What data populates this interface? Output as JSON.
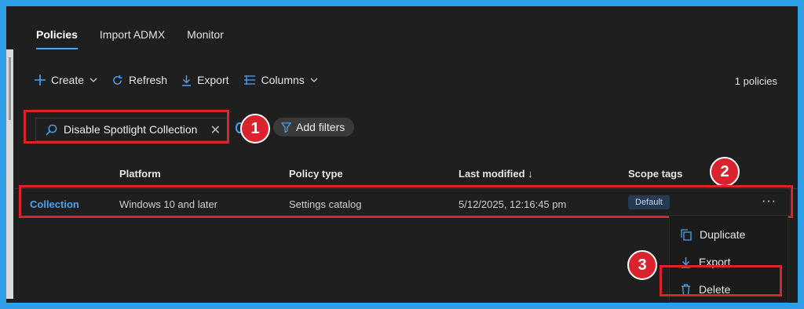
{
  "tabs": [
    {
      "label": "Policies",
      "active": true
    },
    {
      "label": "Import ADMX",
      "active": false
    },
    {
      "label": "Monitor",
      "active": false
    }
  ],
  "toolbar": {
    "create": "Create",
    "refresh": "Refresh",
    "export": "Export",
    "columns": "Columns"
  },
  "count_text": "1 policies",
  "search": {
    "value": "Disable Spotlight Collection"
  },
  "add_filters": "Add filters",
  "table": {
    "headers": {
      "platform": "Platform",
      "policy_type": "Policy type",
      "last_modified": "Last modified ↓",
      "scope_tags": "Scope tags"
    },
    "row": {
      "name": "Collection",
      "platform": "Windows 10 and later",
      "policy_type": "Settings catalog",
      "last_modified": "5/12/2025, 12:16:45 pm",
      "scope_tag": "Default"
    }
  },
  "context_menu": {
    "duplicate": "Duplicate",
    "export": "Export",
    "delete": "Delete"
  },
  "callouts": [
    "1",
    "2",
    "3"
  ],
  "colors": {
    "accent": "#4aa3f0",
    "highlight": "#d9232e",
    "background": "#1f1f1f",
    "border": "#2e9fe6"
  }
}
